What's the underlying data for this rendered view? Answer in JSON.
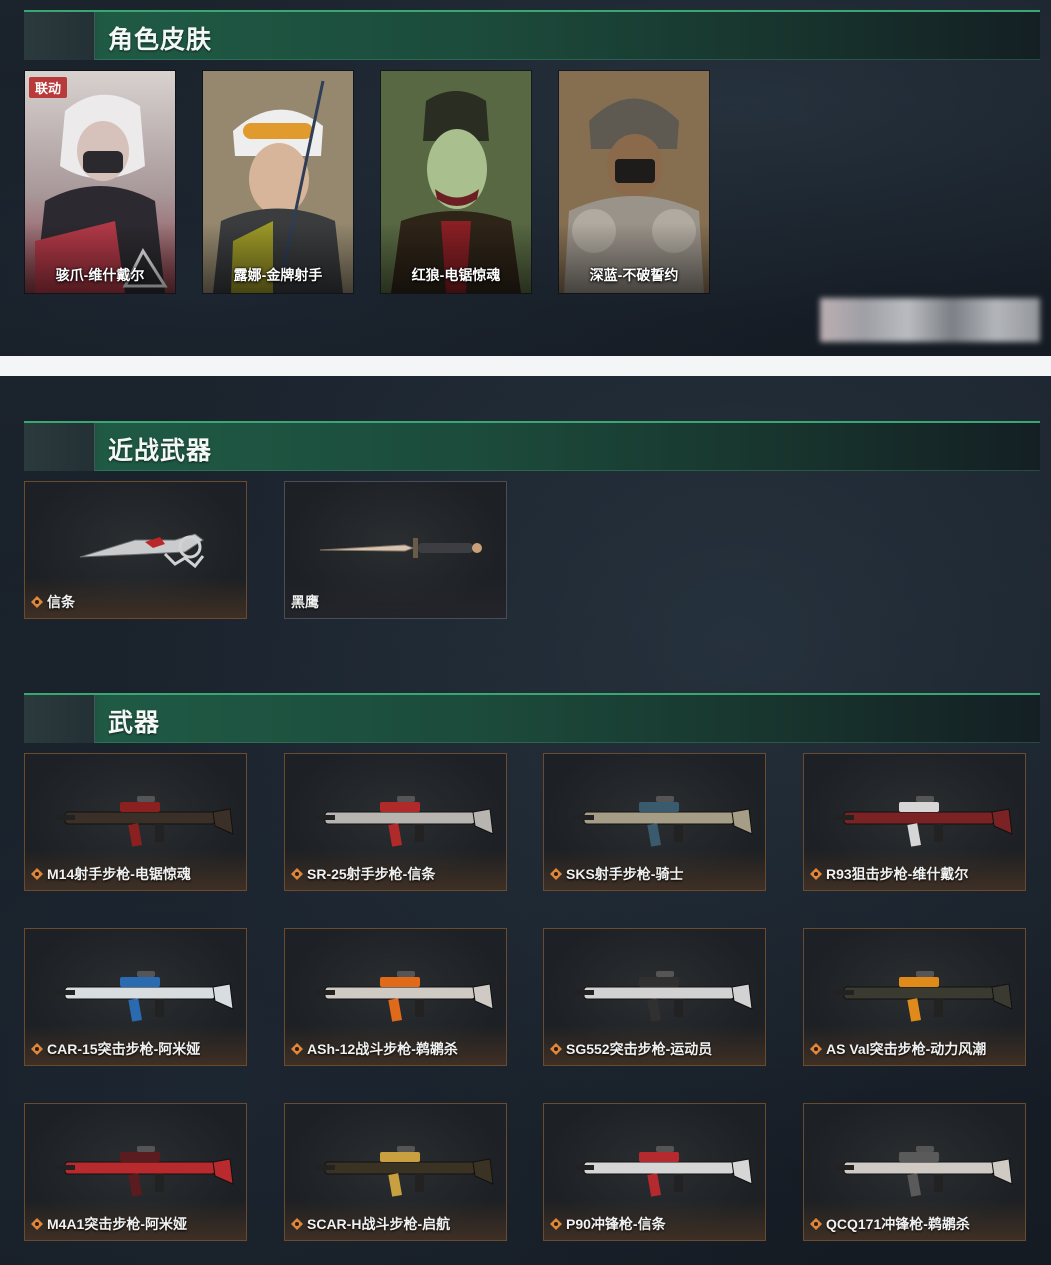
{
  "sections": {
    "skins": {
      "title": "角色皮肤",
      "items": [
        {
          "name": "骇爪-维什戴尔",
          "tag": "联动"
        },
        {
          "name": "露娜-金牌射手"
        },
        {
          "name": "红狼-电锯惊魂"
        },
        {
          "name": "深蓝-不破誓约"
        }
      ]
    },
    "melee": {
      "title": "近战武器",
      "items": [
        {
          "name": "信条",
          "icon": "diamond-rarity-icon"
        },
        {
          "name": "黑鹰"
        }
      ]
    },
    "weapons": {
      "title": "武器",
      "items": [
        {
          "name": "M14射手步枪-电锯惊魂"
        },
        {
          "name": "SR-25射手步枪-信条"
        },
        {
          "name": "SKS射手步枪-骑士"
        },
        {
          "name": "R93狙击步枪-维什戴尔"
        },
        {
          "name": "CAR-15突击步枪-阿米娅"
        },
        {
          "name": "ASh-12战斗步枪-鹈鹕杀"
        },
        {
          "name": "SG552突击步枪-运动员"
        },
        {
          "name": "AS Val突击步枪-动力风潮"
        },
        {
          "name": "M4A1突击步枪-阿米娅"
        },
        {
          "name": "SCAR-H战斗步枪-启航"
        },
        {
          "name": "P90冲锋枪-信条"
        },
        {
          "name": "QCQ171冲锋枪-鹈鹕杀"
        }
      ]
    }
  },
  "colors": {
    "header_accent": "#38a772",
    "card_border": "#6a4b2f",
    "tag_red": "#b83a3a",
    "rarity_orange": "#e0883a"
  }
}
